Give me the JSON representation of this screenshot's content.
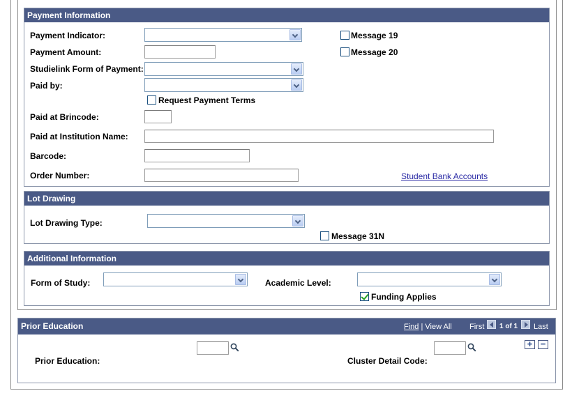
{
  "payment": {
    "header": "Payment Information",
    "payment_indicator_label": "Payment Indicator:",
    "payment_amount_label": "Payment Amount:",
    "studielink_form_label": "Studielink Form of Payment:",
    "paid_by_label": "Paid by:",
    "request_payment_terms_label": "Request Payment Terms",
    "paid_at_brincode_label": "Paid at Brincode:",
    "paid_at_institution_label": "Paid at Institution Name:",
    "barcode_label": "Barcode:",
    "order_number_label": "Order Number:",
    "message19_label": "Message 19",
    "message20_label": "Message 20",
    "student_bank_accounts_link": "Student Bank Accounts",
    "payment_indicator_value": "",
    "payment_amount_value": "",
    "studielink_form_value": "",
    "paid_by_value": "",
    "paid_at_brincode_value": "",
    "paid_at_institution_value": "",
    "barcode_value": "",
    "order_number_value": "",
    "request_payment_terms_checked": false,
    "message19_checked": false,
    "message20_checked": false
  },
  "lot_drawing": {
    "header": "Lot Drawing",
    "type_label": "Lot Drawing Type:",
    "type_value": "",
    "message31n_label": "Message 31N",
    "message31n_checked": false
  },
  "additional": {
    "header": "Additional Information",
    "form_of_study_label": "Form of Study:",
    "form_of_study_value": "",
    "academic_level_label": "Academic Level:",
    "academic_level_value": "",
    "funding_applies_label": "Funding Applies",
    "funding_applies_checked": true
  },
  "prior_education": {
    "header": "Prior Education",
    "find_link": "Find",
    "separator": " | ",
    "view_all_label": "View All",
    "first_label": "First",
    "counter": "1 of 1",
    "last_label": "Last",
    "prior_education_label": "Prior Education:",
    "prior_education_value": "",
    "cluster_detail_label": "Cluster Detail Code:",
    "cluster_detail_value": "",
    "add_row_symbol": "+",
    "delete_row_symbol": "−"
  },
  "colors": {
    "header_bg": "#4a5a86",
    "link": "#2a2aa5",
    "check": "#21a121"
  },
  "icons": {
    "lookup": "magnifier-icon",
    "dropdown": "chevron-down-icon"
  }
}
